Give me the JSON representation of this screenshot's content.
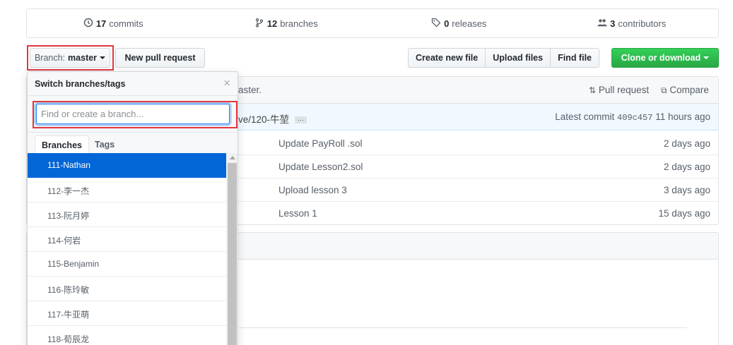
{
  "summary": {
    "commits_count": "17",
    "commits_label": "commits",
    "branches_count": "12",
    "branches_label": "branches",
    "releases_count": "0",
    "releases_label": "releases",
    "contributors_count": "3",
    "contributors_label": "contributors"
  },
  "toolbar": {
    "branch_prefix": "Branch:",
    "branch_name": "master",
    "new_pr": "New pull request",
    "create_file": "Create new file",
    "upload_files": "Upload files",
    "find_file": "Find file",
    "clone": "Clone or download"
  },
  "commit_header": {
    "text_fragment": "aster.",
    "pull_request": "Pull request",
    "compare": "Compare"
  },
  "latest_commit": {
    "branch_fragment": "ve/120-牛堃",
    "label": "Latest commit",
    "sha": "409c457",
    "age": "11 hours ago"
  },
  "files": [
    {
      "message": "Update PayRoll .sol",
      "age": "2 days ago"
    },
    {
      "message": "Update Lesson2.sol",
      "age": "2 days ago"
    },
    {
      "message": "Upload lesson 3",
      "age": "3 days ago"
    },
    {
      "message": "Lesson 1",
      "age": "15 days ago"
    }
  ],
  "dropdown": {
    "title": "Switch branches/tags",
    "placeholder": "Find or create a branch...",
    "tab_branches": "Branches",
    "tab_tags": "Tags",
    "branches": [
      "111-Nathan",
      "112-李一杰",
      "113-阮月婷",
      "114-何岩",
      "115-Benjamin",
      "116-陈玲敏",
      "117-牛亚萌",
      "118-荀辰龙"
    ]
  }
}
